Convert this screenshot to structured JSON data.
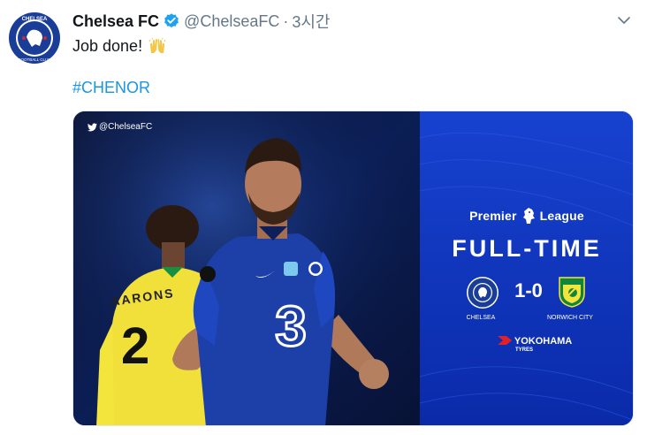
{
  "tweet": {
    "display_name": "Chelsea FC",
    "handle": "@ChelseaFC",
    "separator": "·",
    "time": "3시간",
    "text": "Job done!",
    "emoji": "raising-hands",
    "hashtag": "#CHENOR"
  },
  "media": {
    "watermark": "@ChelseaFC",
    "competition": "Premier League",
    "competition_left": "Premier",
    "competition_right": "League",
    "status": "FULL-TIME",
    "score": "1-0",
    "home_team": "CHELSEA",
    "away_team": "NORWICH CITY",
    "sponsor": "YOKOHAMA",
    "sponsor_sub": "TYRES",
    "player_back_name": "AARONS",
    "player_back_number": "2",
    "colors": {
      "panel": "#0a2ea8",
      "chelsea_blue": "#1c3fa8",
      "norwich_yellow": "#f4e53c",
      "norwich_green": "#12853c"
    }
  },
  "colors": {
    "link": "#1b95e0",
    "muted": "#657786",
    "verified": "#1da1f2"
  }
}
